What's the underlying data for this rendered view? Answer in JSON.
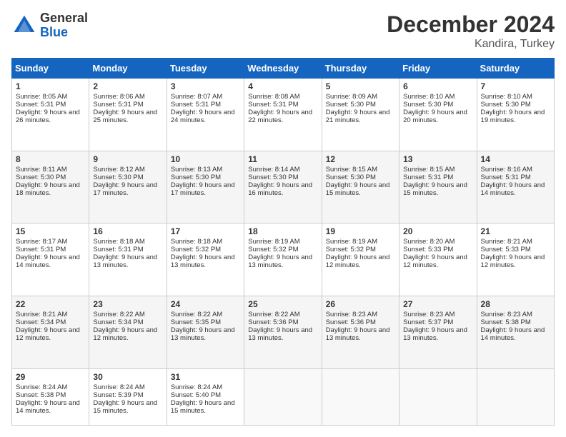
{
  "header": {
    "logo_general": "General",
    "logo_blue": "Blue",
    "month_title": "December 2024",
    "location": "Kandira, Turkey"
  },
  "days_of_week": [
    "Sunday",
    "Monday",
    "Tuesday",
    "Wednesday",
    "Thursday",
    "Friday",
    "Saturday"
  ],
  "weeks": [
    [
      {
        "day": "1",
        "sunrise": "Sunrise: 8:05 AM",
        "sunset": "Sunset: 5:31 PM",
        "daylight": "Daylight: 9 hours and 26 minutes."
      },
      {
        "day": "2",
        "sunrise": "Sunrise: 8:06 AM",
        "sunset": "Sunset: 5:31 PM",
        "daylight": "Daylight: 9 hours and 25 minutes."
      },
      {
        "day": "3",
        "sunrise": "Sunrise: 8:07 AM",
        "sunset": "Sunset: 5:31 PM",
        "daylight": "Daylight: 9 hours and 24 minutes."
      },
      {
        "day": "4",
        "sunrise": "Sunrise: 8:08 AM",
        "sunset": "Sunset: 5:31 PM",
        "daylight": "Daylight: 9 hours and 22 minutes."
      },
      {
        "day": "5",
        "sunrise": "Sunrise: 8:09 AM",
        "sunset": "Sunset: 5:30 PM",
        "daylight": "Daylight: 9 hours and 21 minutes."
      },
      {
        "day": "6",
        "sunrise": "Sunrise: 8:10 AM",
        "sunset": "Sunset: 5:30 PM",
        "daylight": "Daylight: 9 hours and 20 minutes."
      },
      {
        "day": "7",
        "sunrise": "Sunrise: 8:10 AM",
        "sunset": "Sunset: 5:30 PM",
        "daylight": "Daylight: 9 hours and 19 minutes."
      }
    ],
    [
      {
        "day": "8",
        "sunrise": "Sunrise: 8:11 AM",
        "sunset": "Sunset: 5:30 PM",
        "daylight": "Daylight: 9 hours and 18 minutes."
      },
      {
        "day": "9",
        "sunrise": "Sunrise: 8:12 AM",
        "sunset": "Sunset: 5:30 PM",
        "daylight": "Daylight: 9 hours and 17 minutes."
      },
      {
        "day": "10",
        "sunrise": "Sunrise: 8:13 AM",
        "sunset": "Sunset: 5:30 PM",
        "daylight": "Daylight: 9 hours and 17 minutes."
      },
      {
        "day": "11",
        "sunrise": "Sunrise: 8:14 AM",
        "sunset": "Sunset: 5:30 PM",
        "daylight": "Daylight: 9 hours and 16 minutes."
      },
      {
        "day": "12",
        "sunrise": "Sunrise: 8:15 AM",
        "sunset": "Sunset: 5:30 PM",
        "daylight": "Daylight: 9 hours and 15 minutes."
      },
      {
        "day": "13",
        "sunrise": "Sunrise: 8:15 AM",
        "sunset": "Sunset: 5:31 PM",
        "daylight": "Daylight: 9 hours and 15 minutes."
      },
      {
        "day": "14",
        "sunrise": "Sunrise: 8:16 AM",
        "sunset": "Sunset: 5:31 PM",
        "daylight": "Daylight: 9 hours and 14 minutes."
      }
    ],
    [
      {
        "day": "15",
        "sunrise": "Sunrise: 8:17 AM",
        "sunset": "Sunset: 5:31 PM",
        "daylight": "Daylight: 9 hours and 14 minutes."
      },
      {
        "day": "16",
        "sunrise": "Sunrise: 8:18 AM",
        "sunset": "Sunset: 5:31 PM",
        "daylight": "Daylight: 9 hours and 13 minutes."
      },
      {
        "day": "17",
        "sunrise": "Sunrise: 8:18 AM",
        "sunset": "Sunset: 5:32 PM",
        "daylight": "Daylight: 9 hours and 13 minutes."
      },
      {
        "day": "18",
        "sunrise": "Sunrise: 8:19 AM",
        "sunset": "Sunset: 5:32 PM",
        "daylight": "Daylight: 9 hours and 13 minutes."
      },
      {
        "day": "19",
        "sunrise": "Sunrise: 8:19 AM",
        "sunset": "Sunset: 5:32 PM",
        "daylight": "Daylight: 9 hours and 12 minutes."
      },
      {
        "day": "20",
        "sunrise": "Sunrise: 8:20 AM",
        "sunset": "Sunset: 5:33 PM",
        "daylight": "Daylight: 9 hours and 12 minutes."
      },
      {
        "day": "21",
        "sunrise": "Sunrise: 8:21 AM",
        "sunset": "Sunset: 5:33 PM",
        "daylight": "Daylight: 9 hours and 12 minutes."
      }
    ],
    [
      {
        "day": "22",
        "sunrise": "Sunrise: 8:21 AM",
        "sunset": "Sunset: 5:34 PM",
        "daylight": "Daylight: 9 hours and 12 minutes."
      },
      {
        "day": "23",
        "sunrise": "Sunrise: 8:22 AM",
        "sunset": "Sunset: 5:34 PM",
        "daylight": "Daylight: 9 hours and 12 minutes."
      },
      {
        "day": "24",
        "sunrise": "Sunrise: 8:22 AM",
        "sunset": "Sunset: 5:35 PM",
        "daylight": "Daylight: 9 hours and 13 minutes."
      },
      {
        "day": "25",
        "sunrise": "Sunrise: 8:22 AM",
        "sunset": "Sunset: 5:36 PM",
        "daylight": "Daylight: 9 hours and 13 minutes."
      },
      {
        "day": "26",
        "sunrise": "Sunrise: 8:23 AM",
        "sunset": "Sunset: 5:36 PM",
        "daylight": "Daylight: 9 hours and 13 minutes."
      },
      {
        "day": "27",
        "sunrise": "Sunrise: 8:23 AM",
        "sunset": "Sunset: 5:37 PM",
        "daylight": "Daylight: 9 hours and 13 minutes."
      },
      {
        "day": "28",
        "sunrise": "Sunrise: 8:23 AM",
        "sunset": "Sunset: 5:38 PM",
        "daylight": "Daylight: 9 hours and 14 minutes."
      }
    ],
    [
      {
        "day": "29",
        "sunrise": "Sunrise: 8:24 AM",
        "sunset": "Sunset: 5:38 PM",
        "daylight": "Daylight: 9 hours and 14 minutes."
      },
      {
        "day": "30",
        "sunrise": "Sunrise: 8:24 AM",
        "sunset": "Sunset: 5:39 PM",
        "daylight": "Daylight: 9 hours and 15 minutes."
      },
      {
        "day": "31",
        "sunrise": "Sunrise: 8:24 AM",
        "sunset": "Sunset: 5:40 PM",
        "daylight": "Daylight: 9 hours and 15 minutes."
      },
      null,
      null,
      null,
      null
    ]
  ]
}
